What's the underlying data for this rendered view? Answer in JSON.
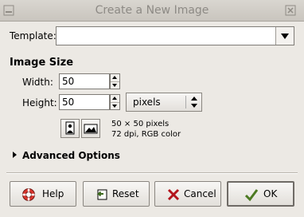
{
  "window": {
    "title": "Create a New Image"
  },
  "template": {
    "label": "Template:",
    "value": ""
  },
  "image_size": {
    "heading": "Image Size",
    "width_label": "Width:",
    "width_value": "50",
    "height_label": "Height:",
    "height_value": "50",
    "unit_value": "pixels",
    "info_line1": "50 × 50 pixels",
    "info_line2": "72 dpi, RGB color"
  },
  "advanced": {
    "label": "Advanced Options"
  },
  "buttons": {
    "help": "Help",
    "reset": "Reset",
    "cancel": "Cancel",
    "ok": "OK"
  }
}
